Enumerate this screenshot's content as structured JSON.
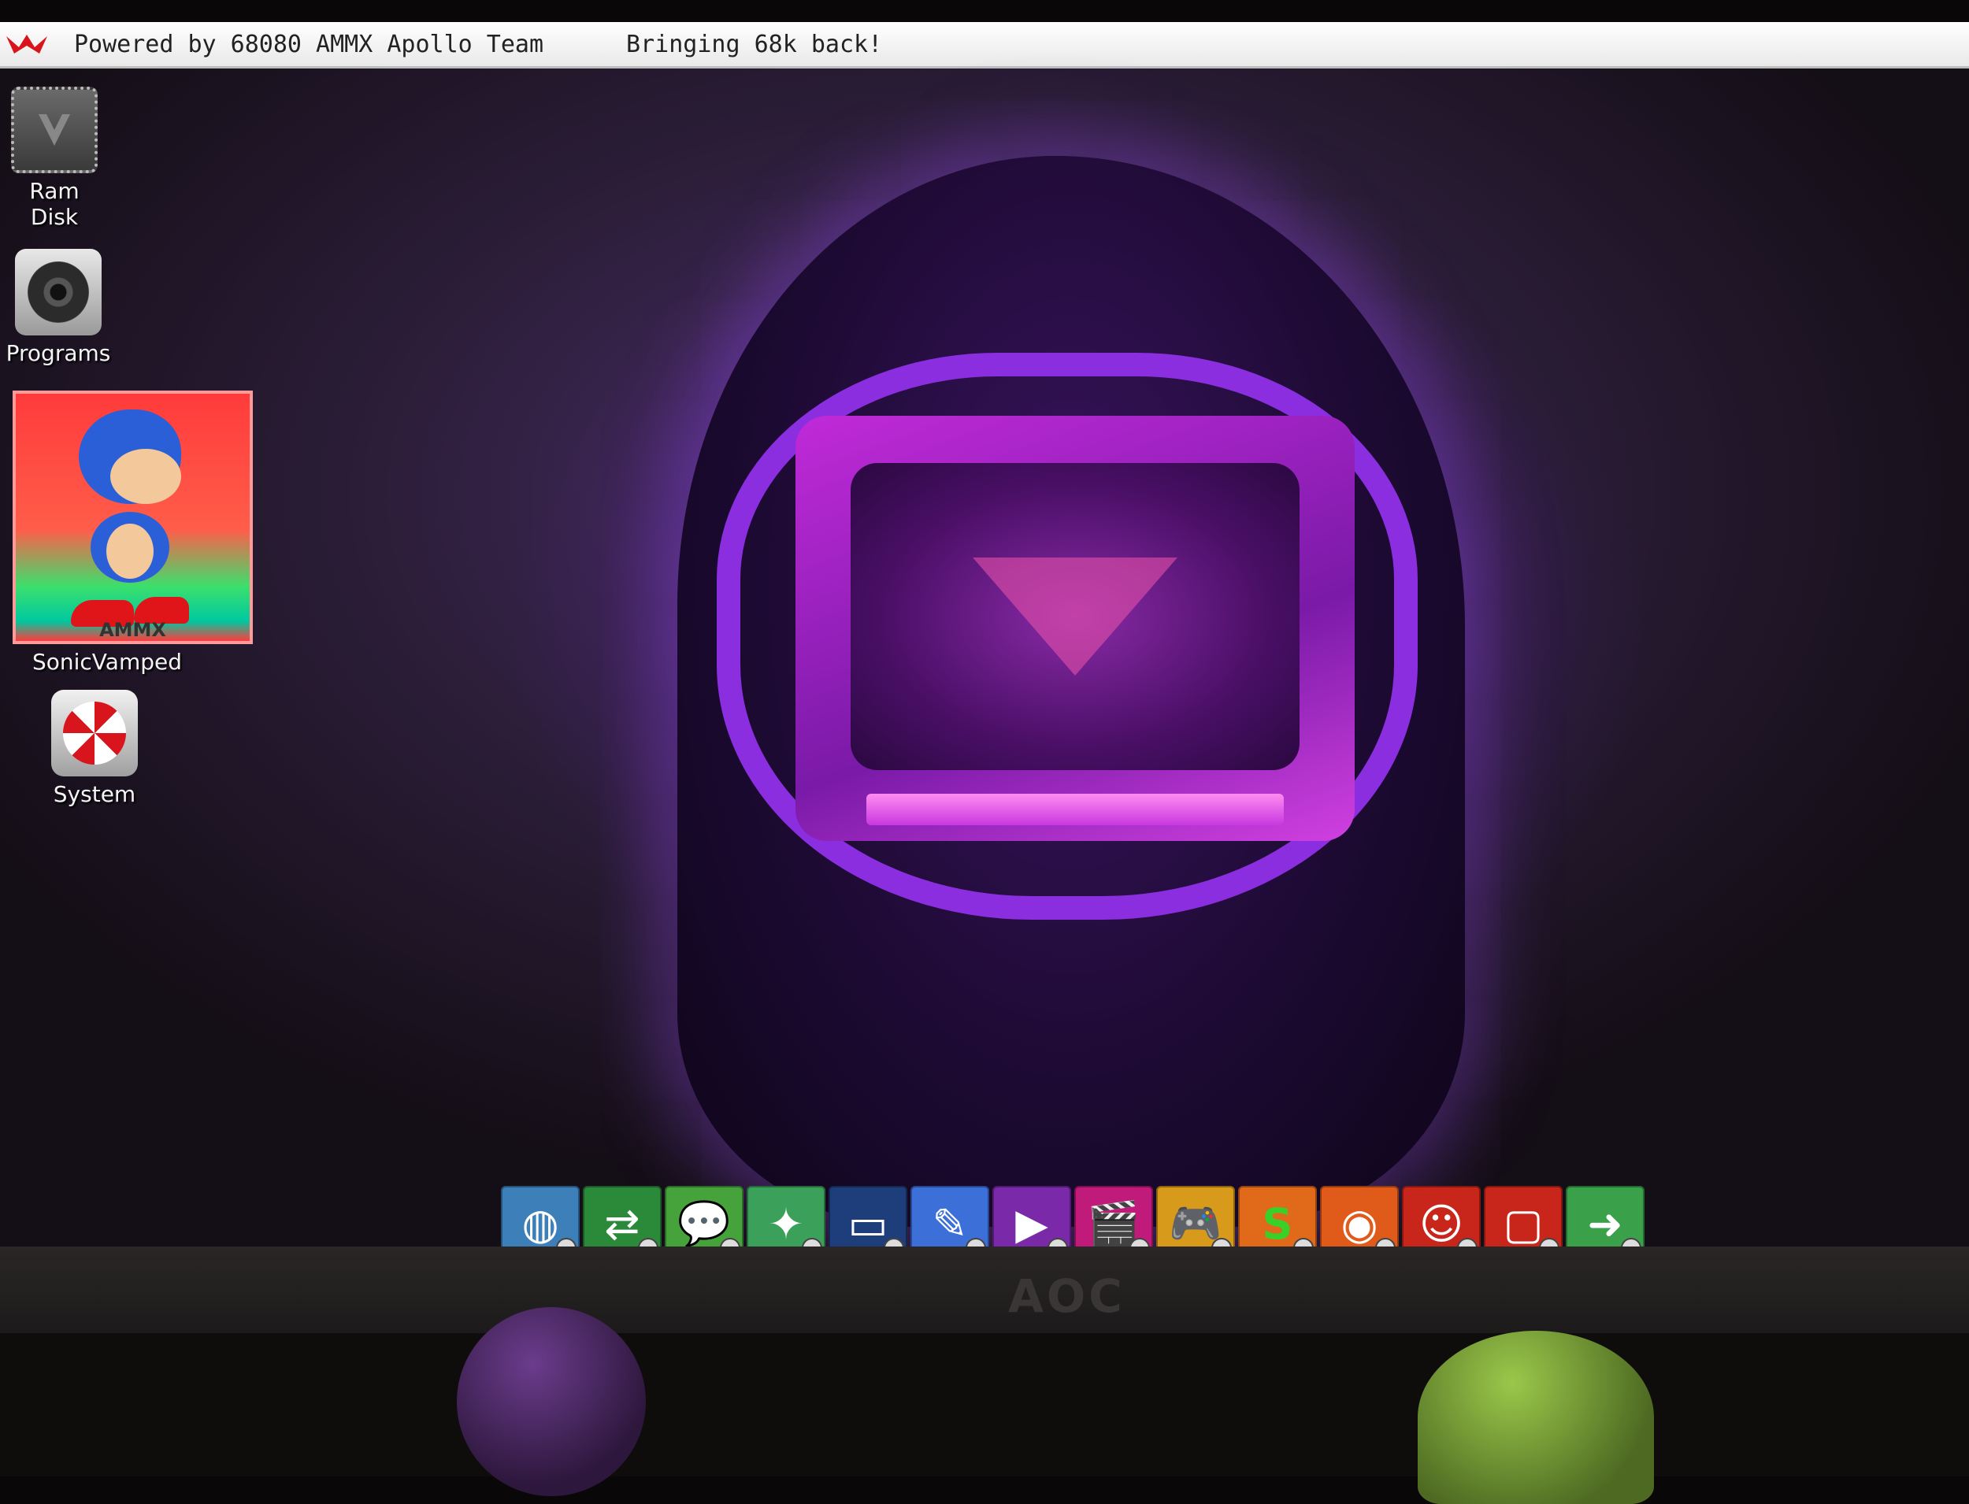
{
  "titlebar": {
    "powered": "Powered by 68080 AMMX Apollo Team",
    "tagline": "Bringing 68k back!"
  },
  "desktop_icons": [
    {
      "label": "Ram Disk",
      "icon": "ram-disk-chip-icon"
    },
    {
      "label": "Programs",
      "icon": "hard-drive-icon"
    },
    {
      "label": "SonicVamped",
      "icon": "sonic-thumbnail",
      "tag": "AMMX"
    },
    {
      "label": "System",
      "icon": "boing-ball-drive-icon"
    }
  ],
  "dock": [
    {
      "icon": "globe-icon",
      "color": "#3d7fb8"
    },
    {
      "icon": "arrows-swap-icon",
      "color": "#2a8a3a"
    },
    {
      "icon": "chat-bubble-icon",
      "color": "#46a33c"
    },
    {
      "icon": "spark-paint-icon",
      "color": "#3aa05a"
    },
    {
      "icon": "terminal-icon",
      "color": "#1d3e7a"
    },
    {
      "icon": "text-editor-icon",
      "color": "#3d6fd8"
    },
    {
      "icon": "media-player-icon",
      "color": "#7a2aa8"
    },
    {
      "icon": "clapperboard-icon",
      "color": "#c01a7a"
    },
    {
      "icon": "gamepad-icon",
      "color": "#d89a1a"
    },
    {
      "icon": "s-app-icon",
      "color": "#e06a1a"
    },
    {
      "icon": "gauge-icon",
      "color": "#e05a1a"
    },
    {
      "icon": "finder-face-icon",
      "color": "#c8261a"
    },
    {
      "icon": "monitor-icon",
      "color": "#c8261a"
    },
    {
      "icon": "floppy-arrow-icon",
      "color": "#3aa04a"
    }
  ],
  "monitor": {
    "brand": "AOC"
  },
  "colors": {
    "accent": "#8a2ee0",
    "titlebar": "#ffffff"
  }
}
